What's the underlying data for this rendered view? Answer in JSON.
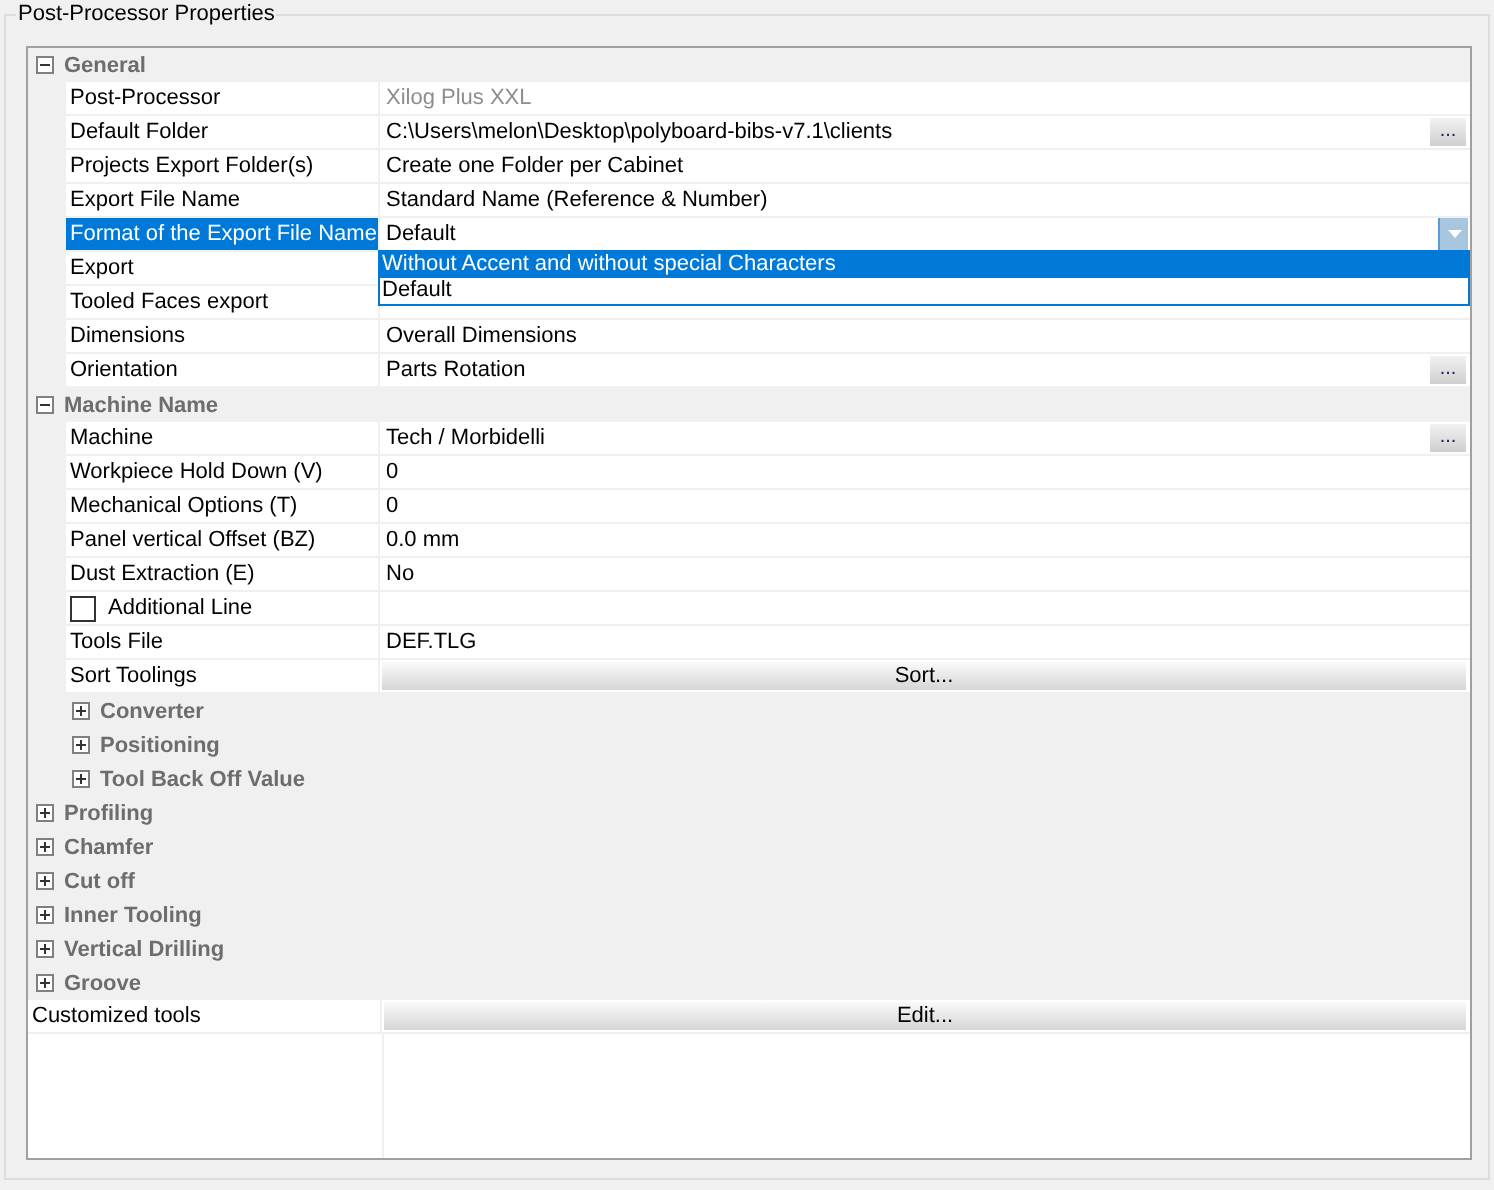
{
  "group_title": "Post-Processor Properties",
  "grid": {
    "items": [
      {
        "kind": "category",
        "name": "General",
        "expanded": true,
        "children": [
          {
            "kind": "property",
            "name": "Post-Processor",
            "value": "Xilog Plus XXL",
            "disabled": true,
            "selected": false
          },
          {
            "kind": "property",
            "name": "Default Folder",
            "value": "C:\\Users\\melon\\Desktop\\polyboard-bibs-v7.1\\clients",
            "disabled": false,
            "selected": false,
            "editor": {
              "kind": "ellipsis",
              "label": "..."
            }
          },
          {
            "kind": "property",
            "name": "Projects Export Folder(s)",
            "value": "Create one Folder per Cabinet",
            "disabled": false,
            "selected": false
          },
          {
            "kind": "property",
            "name": "Export File Name",
            "value": "Standard Name (Reference & Number)",
            "disabled": false,
            "selected": false
          },
          {
            "kind": "property",
            "name": "Format of the Export File Name",
            "value": "Default",
            "disabled": false,
            "selected": true,
            "editor": {
              "kind": "dropdown",
              "options": [
                {
                  "label": "Without Accent and without special Characters",
                  "selected": true
                },
                {
                  "label": "Default",
                  "selected": false
                }
              ]
            }
          },
          {
            "kind": "property",
            "name": "Export",
            "selected": false
          },
          {
            "kind": "property",
            "name": "Tooled Faces export",
            "selected": false
          },
          {
            "kind": "property",
            "name": "Dimensions",
            "value": "Overall Dimensions",
            "disabled": false,
            "selected": false
          },
          {
            "kind": "property",
            "name": "Orientation",
            "value": "Parts Rotation",
            "disabled": false,
            "selected": false,
            "editor": {
              "kind": "ellipsis",
              "label": "..."
            }
          }
        ]
      },
      {
        "kind": "category",
        "name": "Machine Name",
        "expanded": true,
        "children": [
          {
            "kind": "property",
            "name": "Machine",
            "value": "Tech / Morbidelli",
            "disabled": false,
            "selected": false,
            "editor": {
              "kind": "ellipsis",
              "label": "..."
            }
          },
          {
            "kind": "property",
            "name": "Workpiece Hold Down (V)",
            "value": "0",
            "disabled": false,
            "selected": false
          },
          {
            "kind": "property",
            "name": "Mechanical Options (T)",
            "value": "0",
            "disabled": false,
            "selected": false
          },
          {
            "kind": "property",
            "name": "Panel vertical Offset (BZ)",
            "value": "0.0 mm",
            "disabled": false,
            "selected": false
          },
          {
            "kind": "property",
            "name": "Dust Extraction (E)",
            "value": "No",
            "disabled": false,
            "selected": false
          },
          {
            "kind": "property",
            "name": "Additional Line",
            "selected": false,
            "checked": false
          },
          {
            "kind": "property",
            "name": "Tools File",
            "value": "DEF.TLG",
            "disabled": false,
            "selected": false
          },
          {
            "kind": "property",
            "name": "Sort Toolings",
            "selected": false,
            "editor": {
              "kind": "button",
              "label": "Sort..."
            }
          },
          {
            "kind": "category",
            "name": "Converter",
            "expanded": false
          },
          {
            "kind": "category",
            "name": "Positioning",
            "expanded": false
          },
          {
            "kind": "category",
            "name": "Tool Back Off Value",
            "expanded": false
          }
        ]
      },
      {
        "kind": "category",
        "name": "Profiling",
        "expanded": false
      },
      {
        "kind": "category",
        "name": "Chamfer",
        "expanded": false
      },
      {
        "kind": "category",
        "name": "Cut off",
        "expanded": false
      },
      {
        "kind": "category",
        "name": "Inner Tooling",
        "expanded": false
      },
      {
        "kind": "category",
        "name": "Vertical Drilling",
        "expanded": false
      },
      {
        "kind": "category",
        "name": "Groove",
        "expanded": false
      },
      {
        "kind": "property",
        "name": "Customized tools",
        "selected": false,
        "editor": {
          "kind": "button",
          "label": "Edit..."
        }
      }
    ]
  }
}
